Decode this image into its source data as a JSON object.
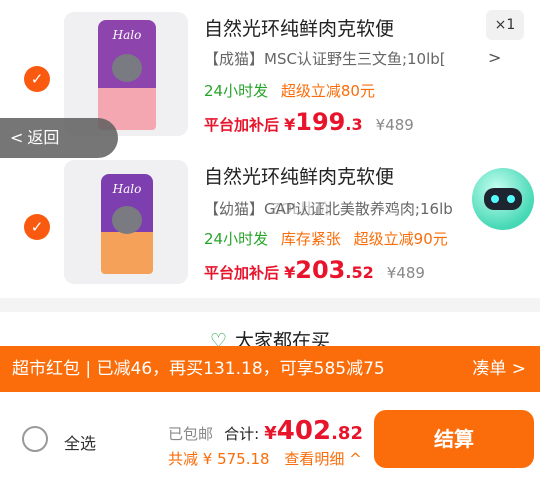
{
  "items": [
    {
      "title": "自然光环纯鲜肉克软便",
      "spec": "【成猫】MSC认证野生三文鱼;10lb[",
      "qty": "×1",
      "tags": [
        {
          "text": "24小时发",
          "color": "green"
        },
        {
          "text": "超级立减80元",
          "color": "orange"
        }
      ],
      "price_label": "平台加补后",
      "price_currency": "¥",
      "price_int": "199",
      "price_dec": ".3",
      "orig_price": "¥489",
      "bag_logo": "Halo"
    },
    {
      "title": "自然光环纯鲜肉克软便",
      "spec": "【幼猫】GAP认证北美散养鸡肉;16lb",
      "qty": "",
      "tags": [
        {
          "text": "24小时发",
          "color": "green"
        },
        {
          "text": "库存紧张",
          "color": "orange"
        },
        {
          "text": "超级立减90元",
          "color": "orange"
        }
      ],
      "price_label": "平台加补后",
      "price_currency": "¥",
      "price_int": "203",
      "price_dec": ".52",
      "orig_price": "¥489",
      "bag_logo": "Halo"
    }
  ],
  "back_button": {
    "label": "返回",
    "icon": "chevron-left-icon"
  },
  "watermark": "ZOL比价",
  "recommend": {
    "title": "大家都在买",
    "icon": "heart-icon"
  },
  "promo": {
    "text": "超市红包 | 已减46，再买131.18，可享585减75",
    "action": "凑单"
  },
  "bottom": {
    "select_all": "全选",
    "free_shipping": "已包邮",
    "total_label": "合计:",
    "total_currency": "¥",
    "total_int": "402",
    "total_dec": ".82",
    "saving": "共减 ¥ 575.18",
    "details": "查看明细",
    "checkout": "结算"
  },
  "colors": {
    "accent": "#fa6d0a",
    "price": "#e8142b",
    "green": "#27a52a"
  }
}
